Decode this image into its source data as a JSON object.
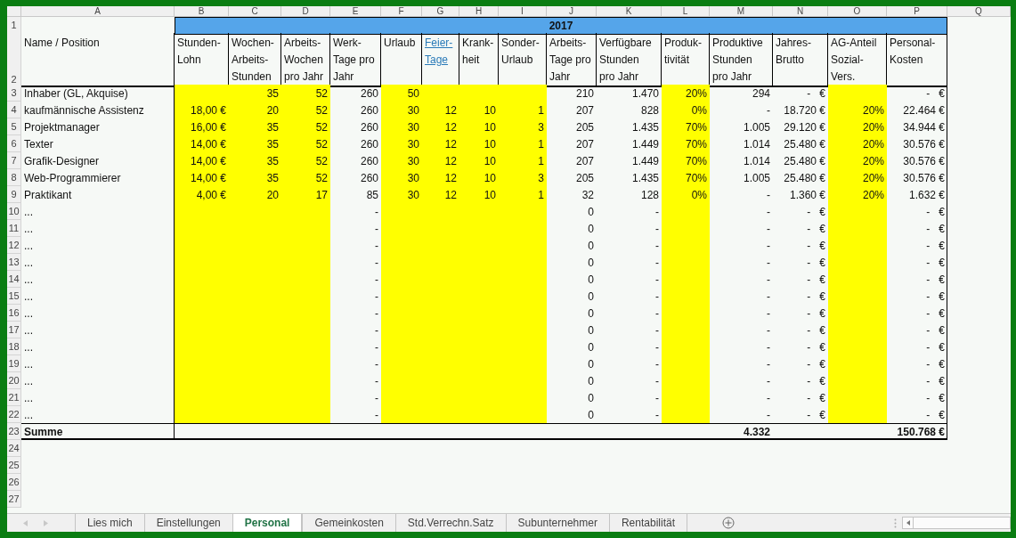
{
  "column_letters": [
    "A",
    "B",
    "C",
    "D",
    "E",
    "F",
    "G",
    "H",
    "I",
    "J",
    "K",
    "L",
    "M",
    "N",
    "O",
    "P",
    "Q"
  ],
  "title_band": {
    "row": "1",
    "text": "2017"
  },
  "header_row": {
    "row": "2",
    "cells": [
      {
        "text": "Name / Position",
        "kind": "text",
        "highlighted": false
      },
      {
        "text": "Stunden-\nLohn",
        "kind": "text",
        "highlighted": true
      },
      {
        "text": "Wochen-\nArbeits-\nStunden",
        "kind": "text",
        "highlighted": true
      },
      {
        "text": "Arbeits-\nWochen\npro Jahr",
        "kind": "text",
        "highlighted": true
      },
      {
        "text": "Werk-\nTage pro\nJahr",
        "kind": "text",
        "highlighted": false
      },
      {
        "text": "Urlaub",
        "kind": "text",
        "highlighted": true
      },
      {
        "text": "Feier-\nTage",
        "kind": "link",
        "highlighted": true
      },
      {
        "text": "Krank-\nheit",
        "kind": "text",
        "highlighted": true
      },
      {
        "text": "Sonder-\nUrlaub",
        "kind": "text",
        "highlighted": true
      },
      {
        "text": "Arbeits-\nTage pro\nJahr",
        "kind": "text",
        "highlighted": false
      },
      {
        "text": "Verfügbare\nStunden\npro Jahr",
        "kind": "text",
        "highlighted": false
      },
      {
        "text": "Produk-\ntivität",
        "kind": "text",
        "highlighted": true
      },
      {
        "text": "Produktive\nStunden\npro Jahr",
        "kind": "text",
        "highlighted": false
      },
      {
        "text": "Jahres-\nBrutto",
        "kind": "text",
        "highlighted": false
      },
      {
        "text": "AG-Anteil\nSozial-\nVers.",
        "kind": "text",
        "highlighted": true
      },
      {
        "text": "Personal-\nKosten",
        "kind": "text",
        "highlighted": false
      }
    ]
  },
  "rows": [
    {
      "row": "3",
      "kind": "data",
      "cells": [
        "Inhaber (GL, Akquise)",
        "",
        "35",
        "52",
        "260",
        "50",
        "",
        "",
        "",
        "210",
        "1.470",
        "20%",
        "294",
        "-   €",
        "",
        "-   €"
      ]
    },
    {
      "row": "4",
      "kind": "data",
      "cells": [
        "kaufmännische Assistenz",
        "18,00 €",
        "20",
        "52",
        "260",
        "30",
        "12",
        "10",
        "1",
        "207",
        "828",
        "0%",
        "-",
        "18.720 €",
        "20%",
        "22.464 €"
      ]
    },
    {
      "row": "5",
      "kind": "data",
      "cells": [
        "Projektmanager",
        "16,00 €",
        "35",
        "52",
        "260",
        "30",
        "12",
        "10",
        "3",
        "205",
        "1.435",
        "70%",
        "1.005",
        "29.120 €",
        "20%",
        "34.944 €"
      ]
    },
    {
      "row": "6",
      "kind": "data",
      "cells": [
        "Texter",
        "14,00 €",
        "35",
        "52",
        "260",
        "30",
        "12",
        "10",
        "1",
        "207",
        "1.449",
        "70%",
        "1.014",
        "25.480 €",
        "20%",
        "30.576 €"
      ]
    },
    {
      "row": "7",
      "kind": "data",
      "cells": [
        "Grafik-Designer",
        "14,00 €",
        "35",
        "52",
        "260",
        "30",
        "12",
        "10",
        "1",
        "207",
        "1.449",
        "70%",
        "1.014",
        "25.480 €",
        "20%",
        "30.576 €"
      ]
    },
    {
      "row": "8",
      "kind": "data",
      "cells": [
        "Web-Programmierer",
        "14,00 €",
        "35",
        "52",
        "260",
        "30",
        "12",
        "10",
        "3",
        "205",
        "1.435",
        "70%",
        "1.005",
        "25.480 €",
        "20%",
        "30.576 €"
      ]
    },
    {
      "row": "9",
      "kind": "data",
      "cells": [
        "Praktikant",
        "4,00 €",
        "20",
        "17",
        "85",
        "30",
        "12",
        "10",
        "1",
        "32",
        "128",
        "0%",
        "-",
        "1.360 €",
        "20%",
        "1.632 €"
      ]
    },
    {
      "row": "10",
      "kind": "data",
      "cells": [
        "...",
        "",
        "",
        "",
        "-",
        "",
        "",
        "",
        "",
        "0",
        "-",
        "",
        "-",
        "-   €",
        "",
        "-   €"
      ]
    },
    {
      "row": "11",
      "kind": "data",
      "cells": [
        "...",
        "",
        "",
        "",
        "-",
        "",
        "",
        "",
        "",
        "0",
        "-",
        "",
        "-",
        "-   €",
        "",
        "-   €"
      ]
    },
    {
      "row": "12",
      "kind": "data",
      "cells": [
        "...",
        "",
        "",
        "",
        "-",
        "",
        "",
        "",
        "",
        "0",
        "-",
        "",
        "-",
        "-   €",
        "",
        "-   €"
      ]
    },
    {
      "row": "13",
      "kind": "data",
      "cells": [
        "...",
        "",
        "",
        "",
        "-",
        "",
        "",
        "",
        "",
        "0",
        "-",
        "",
        "-",
        "-   €",
        "",
        "-   €"
      ]
    },
    {
      "row": "14",
      "kind": "data",
      "cells": [
        "...",
        "",
        "",
        "",
        "-",
        "",
        "",
        "",
        "",
        "0",
        "-",
        "",
        "-",
        "-   €",
        "",
        "-   €"
      ]
    },
    {
      "row": "15",
      "kind": "data",
      "cells": [
        "...",
        "",
        "",
        "",
        "-",
        "",
        "",
        "",
        "",
        "0",
        "-",
        "",
        "-",
        "-   €",
        "",
        "-   €"
      ]
    },
    {
      "row": "16",
      "kind": "data",
      "cells": [
        "...",
        "",
        "",
        "",
        "-",
        "",
        "",
        "",
        "",
        "0",
        "-",
        "",
        "-",
        "-   €",
        "",
        "-   €"
      ]
    },
    {
      "row": "17",
      "kind": "data",
      "cells": [
        "...",
        "",
        "",
        "",
        "-",
        "",
        "",
        "",
        "",
        "0",
        "-",
        "",
        "-",
        "-   €",
        "",
        "-   €"
      ]
    },
    {
      "row": "18",
      "kind": "data",
      "cells": [
        "...",
        "",
        "",
        "",
        "-",
        "",
        "",
        "",
        "",
        "0",
        "-",
        "",
        "-",
        "-   €",
        "",
        "-   €"
      ]
    },
    {
      "row": "19",
      "kind": "data",
      "cells": [
        "...",
        "",
        "",
        "",
        "-",
        "",
        "",
        "",
        "",
        "0",
        "-",
        "",
        "-",
        "-   €",
        "",
        "-   €"
      ]
    },
    {
      "row": "20",
      "kind": "data",
      "cells": [
        "...",
        "",
        "",
        "",
        "-",
        "",
        "",
        "",
        "",
        "0",
        "-",
        "",
        "-",
        "-   €",
        "",
        "-   €"
      ]
    },
    {
      "row": "21",
      "kind": "data",
      "cells": [
        "...",
        "",
        "",
        "",
        "-",
        "",
        "",
        "",
        "",
        "0",
        "-",
        "",
        "-",
        "-   €",
        "",
        "-   €"
      ]
    },
    {
      "row": "22",
      "kind": "data",
      "cells": [
        "...",
        "",
        "",
        "",
        "-",
        "",
        "",
        "",
        "",
        "0",
        "-",
        "",
        "-",
        "-   €",
        "",
        "-   €"
      ]
    },
    {
      "row": "23",
      "kind": "total",
      "cells": [
        "Summe",
        "",
        "",
        "",
        "",
        "",
        "",
        "",
        "",
        "",
        "",
        "",
        "4.332",
        "",
        "",
        "150.768 €"
      ]
    }
  ],
  "empty_rows": [
    "24",
    "25",
    "26",
    "27"
  ],
  "sheet_tabs": [
    {
      "label": "Lies mich",
      "selected": false
    },
    {
      "label": "Einstellungen",
      "selected": false
    },
    {
      "label": "Personal",
      "selected": true
    },
    {
      "label": "Gemeinkosten",
      "selected": false
    },
    {
      "label": "Std.Verrechn.Satz",
      "selected": false
    },
    {
      "label": "Subunternehmer",
      "selected": false
    },
    {
      "label": "Rentabilität",
      "selected": false
    }
  ]
}
